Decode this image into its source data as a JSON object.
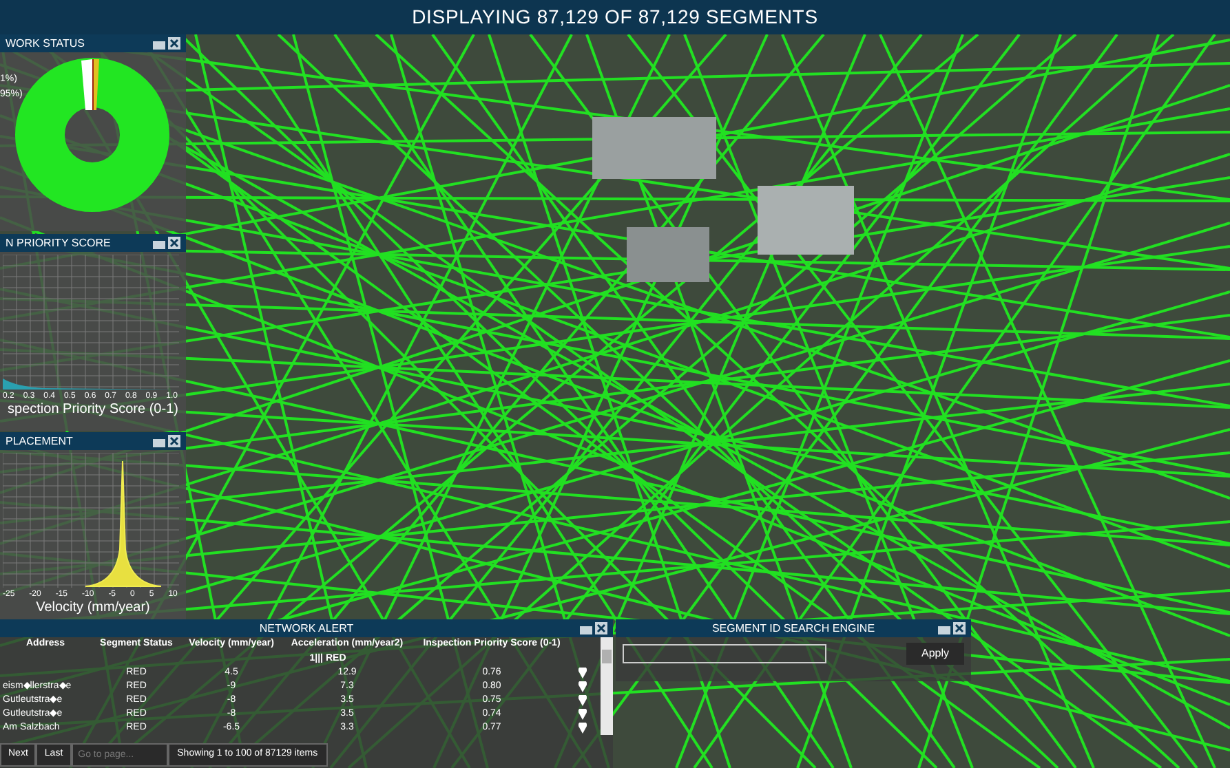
{
  "title_bar": {
    "title": "DISPLAYING 87,129 OF 87,129 SEGMENTS"
  },
  "status_panel": {
    "title": "WORK STATUS",
    "legend": [
      "1%)",
      "95%)"
    ]
  },
  "priority_panel": {
    "title": "N PRIORITY SCORE",
    "xticks": [
      "0.2",
      "0.3",
      "0.4",
      "0.5",
      "0.6",
      "0.7",
      "0.8",
      "0.9",
      "1.0"
    ],
    "xlabel": "spection Priority Score (0-1)"
  },
  "displacement_panel": {
    "title": "PLACEMENT",
    "xticks": [
      "-25",
      "-20",
      "-15",
      "-10",
      "-5",
      "0",
      "5",
      "10"
    ],
    "xlabel": "Velocity (mm/year)"
  },
  "alert_panel": {
    "title": "NETWORK ALERT",
    "columns": [
      "Address",
      "Segment Status",
      "Velocity (mm/year)",
      "Acceleration (mm/year2)",
      "Inspection Priority Score (0-1)"
    ],
    "group": "1||| RED",
    "rows": [
      [
        "",
        "RED",
        "4.5",
        "12.9",
        "0.76"
      ],
      [
        "eism◆llerstra◆e",
        "RED",
        "-9",
        "7.3",
        "0.80"
      ],
      [
        "Gutleutstra◆e",
        "RED",
        "-8",
        "3.5",
        "0.75"
      ],
      [
        "Gutleutstra◆e",
        "RED",
        "-8",
        "3.5",
        "0.74"
      ],
      [
        "Am Salzbach",
        "RED",
        "-6.5",
        "3.3",
        "0.77"
      ]
    ],
    "pager": {
      "buttons": [
        "Next",
        "Last"
      ],
      "placeholder": "Go to page...",
      "info": "Showing 1 to 100 of 87129 items"
    }
  },
  "search_panel": {
    "title": "SEGMENT ID SEARCH ENGINE",
    "button": "Apply"
  }
}
